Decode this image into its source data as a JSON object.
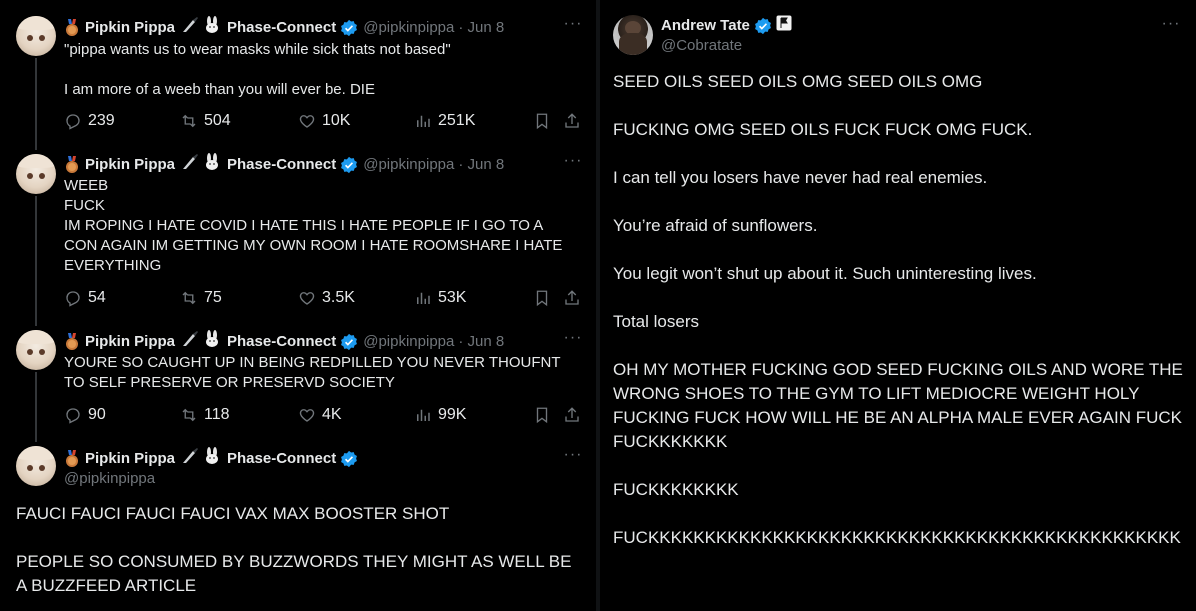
{
  "left_thread": {
    "tweets": [
      {
        "name": "Pipkin Pippa",
        "affiliation": "Phase-Connect",
        "handle": "@pipkinpippa",
        "date": "· Jun 8",
        "text": "\"pippa wants us to wear masks while sick thats not based\"\n\nI am more of a weeb than you will ever be. DIE",
        "replies": "239",
        "reposts": "504",
        "likes": "10K",
        "views": "251K"
      },
      {
        "name": "Pipkin Pippa",
        "affiliation": "Phase-Connect",
        "handle": "@pipkinpippa",
        "date": "· Jun 8",
        "text": "WEEB\nFUCK\nIM ROPING I HATE COVID I HATE THIS I HATE PEOPLE IF I GO TO A CON AGAIN IM GETTING MY OWN ROOM I HATE ROOMSHARE I HATE EVERYTHING",
        "replies": "54",
        "reposts": "75",
        "likes": "3.5K",
        "views": "53K"
      },
      {
        "name": "Pipkin Pippa",
        "affiliation": "Phase-Connect",
        "handle": "@pipkinpippa",
        "date": "· Jun 8",
        "text": "YOURE SO CAUGHT UP IN BEING REDPILLED YOU NEVER THOUFNT TO SELF PRESERVE OR PRESERVD SOCIETY",
        "replies": "90",
        "reposts": "118",
        "likes": "4K",
        "views": "99K"
      }
    ],
    "main_tweet": {
      "name": "Pipkin Pippa",
      "affiliation": "Phase-Connect",
      "handle": "@pipkinpippa",
      "paragraph1": "FAUCI FAUCI FAUCI FAUCI VAX MAX BOOSTER SHOT",
      "paragraph2": "PEOPLE SO CONSUMED BY BUZZWORDS THEY MIGHT AS WELL BE A BUZZFEED ARTICLE"
    }
  },
  "right_tweet": {
    "name": "Andrew Tate",
    "handle": "@Cobratate",
    "paragraphs": [
      "SEED OILS SEED OILS OMG SEED OILS OMG",
      "FUCKING OMG SEED OILS FUCK FUCK OMG FUCK.",
      "I can tell you losers have never had real enemies.",
      "You’re afraid of sunflowers.",
      "You legit won’t shut up about it. Such uninteresting lives.",
      "Total losers",
      "OH MY MOTHER FUCKING GOD SEED FUCKING OILS AND WORE THE WRONG SHOES TO THE GYM TO LIFT MEDIOCRE WEIGHT HOLY FUCKING FUCK HOW WILL HE BE AN ALPHA MALE EVER AGAIN FUCK FUCKKKKKKK",
      "FUCKKKKKKKK",
      "FUCKKKKKKKKKKKKKKKKKKKKKKKKKKKKKKKKKKKKKKKKKKKKKKK"
    ]
  },
  "colors": {
    "background": "#000000",
    "text": "#e7e9ea",
    "muted": "#71767b",
    "verified": "#1d9bf0",
    "thread_line": "#333639"
  },
  "icons": [
    "more-icon",
    "reply-icon",
    "repost-icon",
    "like-icon",
    "views-icon",
    "bookmark-icon",
    "share-icon",
    "verified-badge-icon",
    "medal-icon",
    "knife-emoji-icon",
    "rabbit-emoji-icon",
    "flag-icon"
  ]
}
